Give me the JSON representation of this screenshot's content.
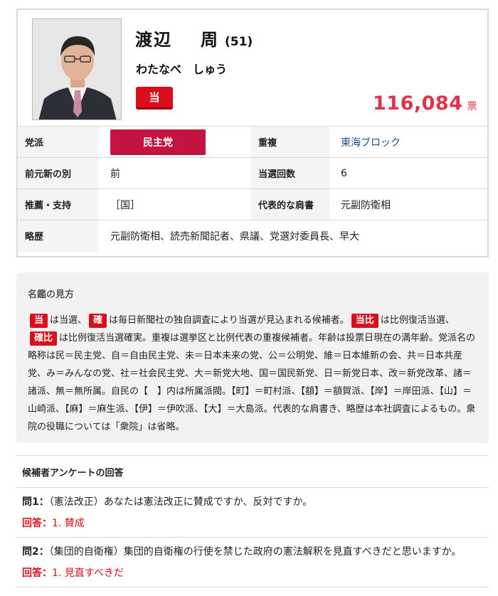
{
  "candidate": {
    "surname": "渡辺",
    "given_name": "周",
    "age": "(51)",
    "kana": "わたなべ　しゅう",
    "result_badge": "当",
    "votes": "116,084",
    "votes_unit": "票",
    "photo_icon": "person-photo-icon"
  },
  "info": {
    "party_label": "党派",
    "party_value": "民主党",
    "duplicate_label": "重複",
    "duplicate_value": "東海ブロック",
    "status_label": "前元新の別",
    "status_value": "前",
    "wins_label": "当選回数",
    "wins_value": "6",
    "support_label": "推薦・支持",
    "support_value": "［国］",
    "title_label": "代表的な肩書",
    "title_value": "元副防衛相",
    "career_label": "略歴",
    "career_value": "元副防衛相、読売新聞記者、県議、党選対委員長、早大"
  },
  "guide": {
    "title": "名鑑の見方",
    "tag_win": "当",
    "text1": "は当選、",
    "tag_sure": "確",
    "text2": "は毎日新聞社の独自調査により当選が見込まれる候補者。",
    "tag_revive": "当比",
    "text3": "は比例復活当選、",
    "tag_revive_sure": "確比",
    "text4": "は比例復活当選確実。重複は選挙区と比例代表の重複候補者。年齢は投票日現在の満年齢。党派名の略称は民＝民主党、自＝自由民主党、未＝日本未来の党、公＝公明党、維＝日本維新の会、共＝日本共産党、み＝みんなの党、社＝社会民主党、大＝新党大地、国＝国民新党、日＝新党日本、改＝新党改革、諸＝諸派、無＝無所属。自民の【　】内は所属派閥。【町】＝町村派、【額】＝額賀派、【岸】＝岸田派、【山】＝山崎派、【麻】＝麻生派、【伊】＝伊吹派、【大】＝大島派。代表的な肩書き、略歴は本社調査によるもの。衆院の役職については「衆院」は省略。"
  },
  "survey": {
    "title": "候補者アンケートの回答",
    "questions": [
      {
        "number": "問1：",
        "text": "（憲法改正）あなたは憲法改正に賛成ですか、反対ですか。",
        "answer_label": "回答：",
        "answer": "1. 賛成"
      },
      {
        "number": "問2：",
        "text": "（集団的自衛権）集団的自衛権の行使を禁じた政府の憲法解釈を見直すべきだと思いますか。",
        "answer_label": "回答：",
        "answer": "1. 見直すべきだ"
      }
    ]
  },
  "colors": {
    "badge_red": "#d9101c",
    "party_red": "#c2143e",
    "votes_pink": "#e0334a",
    "link_blue": "#1f4e8c"
  }
}
